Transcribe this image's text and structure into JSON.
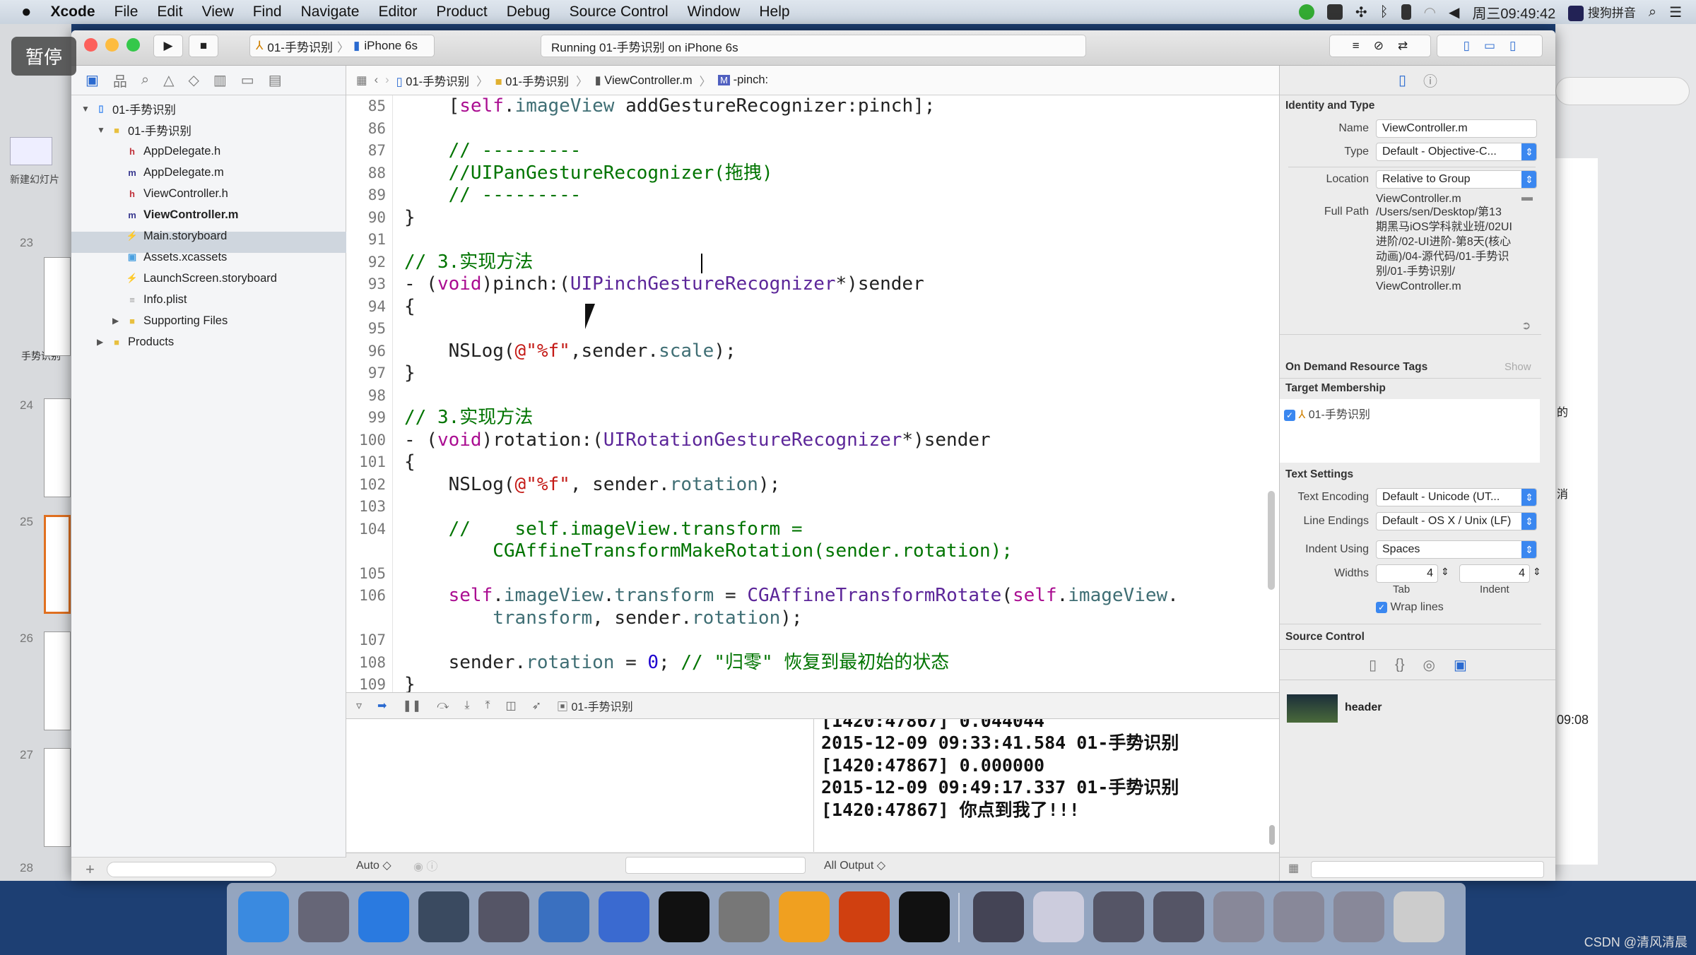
{
  "menubar": {
    "items": [
      "Xcode",
      "File",
      "Edit",
      "View",
      "Find",
      "Navigate",
      "Editor",
      "Product",
      "Debug",
      "Source Control",
      "Window",
      "Help"
    ],
    "clock": "周三09:49:42",
    "input_method": "搜狗拼音"
  },
  "background": {
    "pause_label": "暂停",
    "new_slide": "新建幻灯片",
    "slide_numbers": [
      "23",
      "24",
      "25",
      "26",
      "27",
      "28"
    ],
    "section": "手势识别",
    "right_fragments": [
      "的",
      "消",
      "09:08"
    ],
    "watermark": "CSDN @清风清晨"
  },
  "toolbar": {
    "scheme": "01-手势识别",
    "device": "iPhone 6s",
    "activity": "Running 01-手势识别 on iPhone 6s"
  },
  "jumpbar": [
    "01-手势识别",
    "01-手势识别",
    "ViewController.m",
    "-pinch:"
  ],
  "navigator": {
    "items": [
      {
        "label": "01-手势识别",
        "icon": "project",
        "depth": 0,
        "open": true
      },
      {
        "label": "01-手势识别",
        "icon": "folder",
        "depth": 1,
        "open": true
      },
      {
        "label": "AppDelegate.h",
        "icon": "h",
        "depth": 2
      },
      {
        "label": "AppDelegate.m",
        "icon": "m",
        "depth": 2
      },
      {
        "label": "ViewController.h",
        "icon": "h",
        "depth": 2
      },
      {
        "label": "ViewController.m",
        "icon": "m",
        "depth": 2,
        "selected": true
      },
      {
        "label": "Main.storyboard",
        "icon": "storyboard",
        "depth": 2
      },
      {
        "label": "Assets.xcassets",
        "icon": "assets",
        "depth": 2
      },
      {
        "label": "LaunchScreen.storyboard",
        "icon": "storyboard",
        "depth": 2
      },
      {
        "label": "Info.plist",
        "icon": "plist",
        "depth": 2
      },
      {
        "label": "Supporting Files",
        "icon": "folder",
        "depth": 2,
        "open": false
      },
      {
        "label": "Products",
        "icon": "folder",
        "depth": 1,
        "open": false
      }
    ]
  },
  "editor": {
    "lines": [
      {
        "n": "85",
        "t": [
          [
            "    ["
          ],
          [
            "self",
            "k"
          ],
          [
            "."
          ],
          [
            "imageView",
            "p"
          ],
          [
            " addGestureRecognizer:pinch];"
          ]
        ]
      },
      {
        "n": "86",
        "t": []
      },
      {
        "n": "87",
        "t": [
          [
            "    // ---------",
            "c"
          ]
        ]
      },
      {
        "n": "88",
        "t": [
          [
            "    //UIPanGestureRecognizer(拖拽)",
            "c"
          ]
        ]
      },
      {
        "n": "89",
        "t": [
          [
            "    // ---------",
            "c"
          ]
        ]
      },
      {
        "n": "90",
        "t": [
          [
            "}"
          ]
        ]
      },
      {
        "n": "91",
        "t": []
      },
      {
        "n": "92",
        "t": [
          [
            "// 3.实现方法",
            "c"
          ]
        ]
      },
      {
        "n": "93",
        "t": [
          [
            "- ("
          ],
          [
            "void",
            "k"
          ],
          [
            ")pinch:("
          ],
          [
            "UIPinchGestureRecognizer",
            "t"
          ],
          [
            "*)sender"
          ]
        ]
      },
      {
        "n": "94",
        "t": [
          [
            "{"
          ]
        ]
      },
      {
        "n": "95",
        "t": []
      },
      {
        "n": "96",
        "t": [
          [
            "    NSLog("
          ],
          [
            "@\"%f\"",
            "s"
          ],
          [
            ",sender."
          ],
          [
            "scale",
            "p"
          ],
          [
            ");"
          ]
        ]
      },
      {
        "n": "97",
        "t": [
          [
            "}"
          ]
        ]
      },
      {
        "n": "98",
        "t": []
      },
      {
        "n": "99",
        "t": [
          [
            "// 3.实现方法",
            "c"
          ]
        ]
      },
      {
        "n": "100",
        "t": [
          [
            "- ("
          ],
          [
            "void",
            "k"
          ],
          [
            ")rotation:("
          ],
          [
            "UIRotationGestureRecognizer",
            "t"
          ],
          [
            "*)sender"
          ]
        ]
      },
      {
        "n": "101",
        "t": [
          [
            "{"
          ]
        ]
      },
      {
        "n": "102",
        "t": [
          [
            "    NSLog("
          ],
          [
            "@\"%f\"",
            "s"
          ],
          [
            ", sender."
          ],
          [
            "rotation",
            "p"
          ],
          [
            ");"
          ]
        ]
      },
      {
        "n": "103",
        "t": []
      },
      {
        "n": "104",
        "t": [
          [
            "    //    self.imageView.transform =",
            "c"
          ]
        ],
        "wrap": [
          [
            "        CGAffineTransformMakeRotation(sender.rotation);",
            "c"
          ]
        ]
      },
      {
        "n": "105",
        "t": []
      },
      {
        "n": "106",
        "t": [
          [
            "    "
          ],
          [
            "self",
            "k"
          ],
          [
            "."
          ],
          [
            "imageView",
            "p"
          ],
          [
            "."
          ],
          [
            "transform",
            "p"
          ],
          [
            " = "
          ],
          [
            "CGAffineTransformRotate",
            "t"
          ],
          [
            "("
          ],
          [
            "self",
            "k"
          ],
          [
            "."
          ],
          [
            "imageView",
            "p"
          ],
          [
            "."
          ]
        ],
        "wrap": [
          [
            "        "
          ],
          [
            "transform",
            "p"
          ],
          [
            ", sender."
          ],
          [
            "rotation",
            "p"
          ],
          [
            ");"
          ]
        ]
      },
      {
        "n": "107",
        "t": []
      },
      {
        "n": "108",
        "t": [
          [
            "    sender."
          ],
          [
            "rotation",
            "p"
          ],
          [
            " = "
          ],
          [
            "0",
            "n"
          ],
          [
            "; "
          ],
          [
            "// \"归零\" 恢复到最初始的状态",
            "c"
          ]
        ]
      },
      {
        "n": "109",
        "t": [
          [
            "}"
          ]
        ]
      }
    ]
  },
  "debugbar": {
    "target": "01-手势识别"
  },
  "console": {
    "lines": [
      "[1420:47867] 0.044044",
      "2015-12-09 09:33:41.584 01-手势识别",
      "[1420:47867] 0.000000",
      "2015-12-09 09:49:17.337 01-手势识别",
      "[1420:47867] 你点到我了!!!"
    ]
  },
  "bottombar": {
    "auto": "Auto ◇",
    "output": "All Output ◇"
  },
  "inspector": {
    "identity_title": "Identity and Type",
    "name_label": "Name",
    "name_value": "ViewController.m",
    "type_label": "Type",
    "type_value": "Default - Objective-C...",
    "location_label": "Location",
    "location_value": "Relative to Group",
    "location_file": "ViewController.m",
    "fullpath_label": "Full Path",
    "fullpath_value": "/Users/sen/Desktop/第13\n期黑马iOS学科就业班/02UI\n进阶/02-UI进阶-第8天(核心\n动画)/04-源代码/01-手势识\n别/01-手势识别/\nViewController.m",
    "odr_title": "On Demand Resource Tags",
    "odr_show": "Show",
    "target_title": "Target Membership",
    "target_item": "01-手势识别",
    "target_checked": true,
    "text_title": "Text Settings",
    "encoding_label": "Text Encoding",
    "encoding_value": "Default - Unicode (UT...",
    "endings_label": "Line Endings",
    "endings_value": "Default - OS X / Unix (LF)",
    "indent_label": "Indent Using",
    "indent_value": "Spaces",
    "widths_label": "Widths",
    "tab_value": "4",
    "indent_width_value": "4",
    "tab_label": "Tab",
    "indent_sub_label": "Indent",
    "wrap_label": "Wrap lines",
    "wrap_checked": true,
    "sc_title": "Source Control",
    "library_item": "header"
  },
  "dock": {
    "apps": [
      "finder",
      "launchpad",
      "safari",
      "mouse-app",
      "video-app",
      "xcode",
      "instruments",
      "terminal",
      "system-preferences",
      "sketch",
      "powerpoint",
      "exec-terminal",
      "quicktime",
      "preview",
      "window-1",
      "window-2",
      "window-3",
      "window-4",
      "window-5",
      "trash"
    ]
  },
  "colors": {
    "keyword": "#aa0d91",
    "comment": "#007400",
    "string": "#c41a16",
    "number": "#1c00cf",
    "type": "#5c2699",
    "property": "#3f6e74",
    "accent": "#3a87f0"
  }
}
